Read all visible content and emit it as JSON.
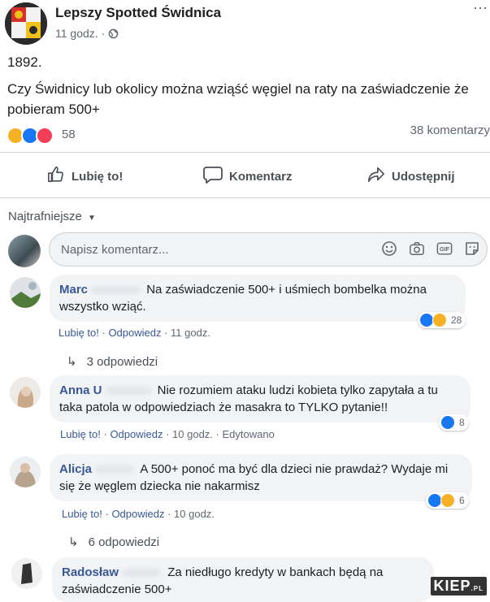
{
  "post": {
    "page_name": "Lepszy Spotted Świdnica",
    "time": "11 godz.",
    "privacy_icon": "globe-icon",
    "more_icon": "more-icon",
    "number_line": "1892.",
    "text": "Czy Świdnicy lub okolicy można wziąść węgiel na raty na zaświadczenie że pobieram 500+",
    "reactions": {
      "icons": [
        "haha",
        "like",
        "love"
      ],
      "count": "58"
    },
    "comments_count": "38 komentarzy"
  },
  "actions": {
    "like": "Lubię to!",
    "comment": "Komentarz",
    "share": "Udostępnij"
  },
  "sort": {
    "label": "Najtrafniejsze"
  },
  "composer": {
    "placeholder": "Napisz komentarz...",
    "icons": [
      "emoji-icon",
      "camera-icon",
      "gif-icon",
      "sticker-icon"
    ]
  },
  "comments": [
    {
      "author": "Marc",
      "text": "Na zaświadczenie 500+ i uśmiech bombelka można wszystko wziąć.",
      "reactions": {
        "icons": [
          "like",
          "haha"
        ],
        "count": "28"
      },
      "like": "Lubię to!",
      "reply": "Odpowiedz",
      "time": "11 godz.",
      "edited": "",
      "replies": "3 odpowiedzi"
    },
    {
      "author": "Anna U",
      "text": "Nie rozumiem ataku ludzi kobieta tylko zapytała a tu taka patola w odpowiedziach że masakra to TYLKO pytanie!!",
      "reactions": {
        "icons": [
          "like"
        ],
        "count": "8"
      },
      "like": "Lubię to!",
      "reply": "Odpowiedz",
      "time": "10 godz.",
      "edited": "Edytowano",
      "replies": ""
    },
    {
      "author": "Alicja",
      "text": "A 500+ ponoć ma być dla dzieci nie prawdaż? Wydaje mi się że węglem dziecka nie nakarmisz",
      "reactions": {
        "icons": [
          "like",
          "haha"
        ],
        "count": "6"
      },
      "like": "Lubię to!",
      "reply": "Odpowiedz",
      "time": "10 godz.",
      "edited": "",
      "replies": "6 odpowiedzi"
    },
    {
      "author": "Radosław",
      "text": "Za niedługo kredyty w bankach będą na zaświadczenie 500+",
      "reactions": {
        "icons": [],
        "count": ""
      },
      "like": "",
      "reply": "",
      "time": "",
      "edited": "",
      "replies": ""
    }
  ],
  "watermark": {
    "main": "KIEP",
    "suffix": ".PL"
  },
  "colors": {
    "like": "#1877f2",
    "haha": "#f7b125",
    "love": "#f33e58",
    "link": "#385898"
  }
}
